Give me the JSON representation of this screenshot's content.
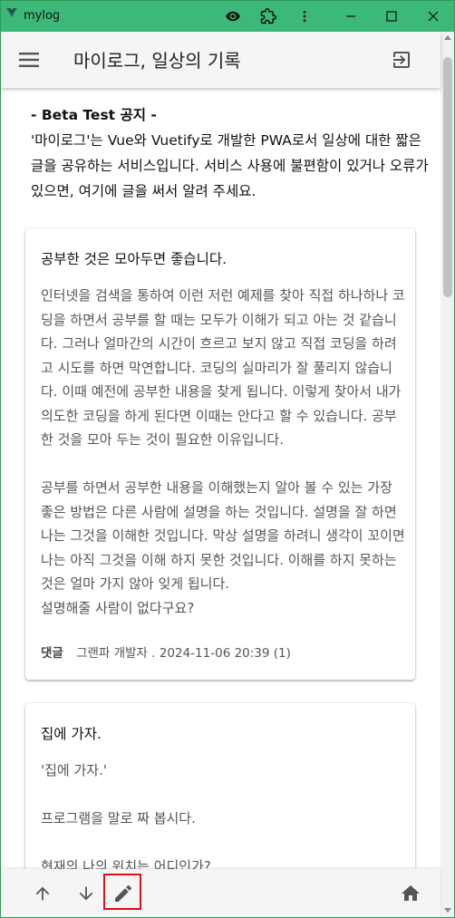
{
  "window": {
    "title": "mylog",
    "icons": [
      "eye-icon",
      "extension-icon",
      "more-vert-icon",
      "minimize-icon",
      "maximize-icon",
      "close-icon"
    ]
  },
  "appbar": {
    "title": "마이로그, 일상의 기록",
    "menu_icon": "menu-icon",
    "logout_icon": "logout-icon"
  },
  "notice": {
    "title": "- Beta Test 공지 -",
    "body": "'마이로그'는 Vue와 Vuetify로 개발한 PWA로서 일상에 대한 짧은 글을 공유하는 서비스입니다. 서비스 사용에 불편함이 있거나 오류가 있으면, 여기에 글을 써서 알려 주세요."
  },
  "posts": [
    {
      "title": "공부한 것은 모아두면 좋습니다.",
      "body": "인터넷을 검색을 통하여 이런 저런 예제를 찾아 직접 하나하나 코딩을 하면서 공부를 할 때는 모두가 이해가 되고 아는 것 같습니다. 그러나 얼마간의 시간이 흐르고 보지 않고 직접 코딩을 하려고 시도를 하면 막연합니다. 코딩의 실마리가 잘 풀리지 않습니다. 이때 예전에 공부한 내용을 찾게 됩니다. 이렇게 찾아서 내가 의도한 코딩을 하게 된다면 이때는 안다고 할 수 있습니다. 공부한 것을 모아 두는 것이 필요한 이유입니다.\n\n공부를 하면서 공부한 내용을 이해했는지 알아 볼 수 있는 가장 좋은 방법은 다른 사람에 설명을 하는 것입니다. 설명을 잘 하면 나는 그것을 이해한 것입니다. 막상 설명을 하려니 생각이 꼬이면 나는 아직 그것을 이해 하지 못한 것입니다. 이해를 하지 못하는 것은 얼마 가지 않아 잊게 됩니다.\n설명해줄 사람이 없다구요?",
      "comment_label": "댓글",
      "meta": "그랜파 개발자 . 2024-11-06 20:39 (1)"
    },
    {
      "title": "집에 가자.",
      "body": "'집에 가자.'\n\n프로그램을 말로 짜 봅시다.\n\n현재의 나의 위치는 어디인가?"
    }
  ],
  "bottombar": {
    "icons": [
      "arrow-up-icon",
      "arrow-down-icon",
      "pencil-icon",
      "home-icon"
    ]
  },
  "colors": {
    "titlebar": "#3cb878",
    "appbar": "#f5f5f5",
    "highlight": "#e01010"
  }
}
